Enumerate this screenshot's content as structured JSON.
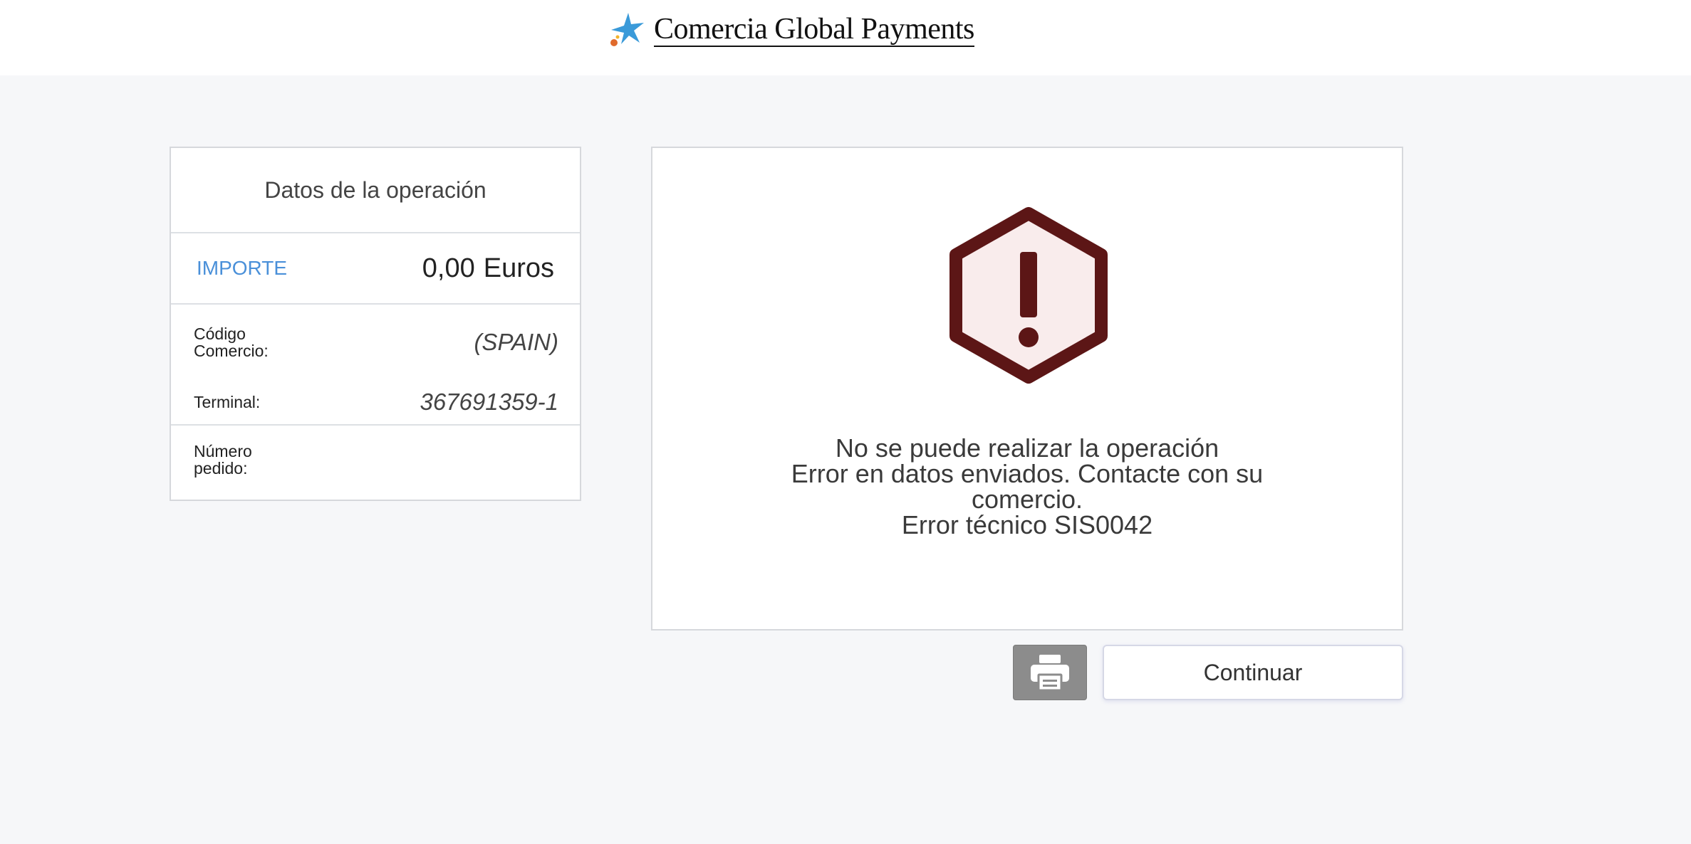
{
  "header": {
    "brand_name": "Comercia Global Payments",
    "logo_icon": "star-logo-icon",
    "logo_colors": [
      "#3a9ad9",
      "#e06a2c"
    ]
  },
  "operation": {
    "title": "Datos de la operación",
    "amount_label": "IMPORTE",
    "amount_value": "0,00",
    "amount_currency": "Euros",
    "rows": {
      "codigo_label": "Código Comercio:",
      "codigo_value": "(SPAIN)",
      "terminal_label": "Terminal:",
      "terminal_value": "367691359-1",
      "pedido_label": "Número pedido:",
      "pedido_value": ""
    }
  },
  "message": {
    "icon": "warning-hexagon-icon",
    "icon_color": "#5c1616",
    "icon_fill": "#f9ecec",
    "line1": "No se puede realizar la operación",
    "line2": "Error en datos enviados. Contacte con su comercio.",
    "line3": "Error técnico SIS0042"
  },
  "actions": {
    "print_icon": "printer-icon",
    "continue_label": "Continuar"
  },
  "colors": {
    "accent": "#4a90d9",
    "background": "#f6f7f9",
    "print_button": "#8c8c8c"
  }
}
